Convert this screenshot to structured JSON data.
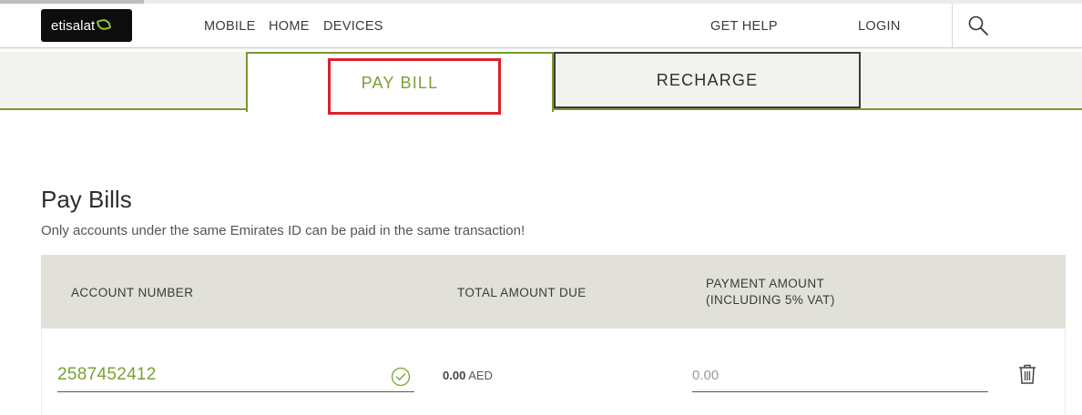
{
  "header": {
    "logo_text": "etisalat",
    "nav": [
      "MOBILE",
      "HOME",
      "DEVICES"
    ],
    "get_help": "GET HELP",
    "login": "LOGIN",
    "search_icon": "search-icon"
  },
  "tabs": {
    "pay_bill": "PAY BILL",
    "recharge": "RECHARGE",
    "active": "PAY BILL"
  },
  "page": {
    "title": "Pay Bills",
    "note": "Only accounts under the same Emirates ID can be paid in the same transaction!"
  },
  "table": {
    "headers": {
      "account_number": "ACCOUNT NUMBER",
      "total_due": "TOTAL AMOUNT DUE",
      "payment_amount_line1": "PAYMENT AMOUNT",
      "payment_amount_line2": "(INCLUDING 5% VAT)"
    },
    "rows": [
      {
        "account_number": "2587452412",
        "total_due_value": "0.00",
        "total_due_currency": "AED",
        "payment_placeholder": "0.00"
      }
    ]
  },
  "colors": {
    "brand_green": "#79a134",
    "highlight_red": "#d9232a",
    "header_gray": "#e1e1da"
  }
}
